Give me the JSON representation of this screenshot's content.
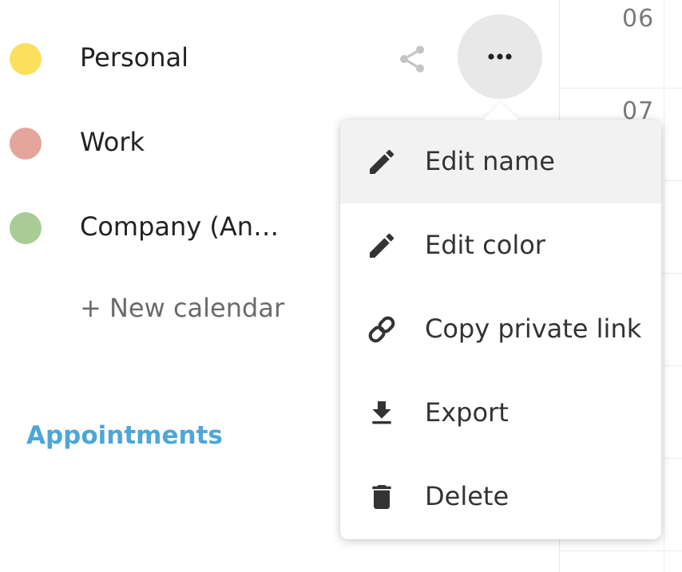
{
  "calendars": [
    {
      "name": "Personal",
      "color": "#fbe05e"
    },
    {
      "name": "Work",
      "color": "#e3a59c"
    },
    {
      "name": "Company (An…",
      "color": "#a9cc96"
    }
  ],
  "sidebar": {
    "new_calendar_label": "+ New calendar",
    "appointments_label": "Appointments",
    "accent_color": "#4ea6d8"
  },
  "grid": {
    "hours": [
      "06",
      "07"
    ]
  },
  "menu": {
    "items": [
      {
        "label": "Edit name",
        "icon": "pencil-icon",
        "active": true
      },
      {
        "label": "Edit color",
        "icon": "pencil-icon",
        "active": false
      },
      {
        "label": "Copy private link",
        "icon": "link-icon",
        "active": false
      },
      {
        "label": "Export",
        "icon": "download-icon",
        "active": false
      },
      {
        "label": "Delete",
        "icon": "trash-icon",
        "active": false
      }
    ]
  }
}
